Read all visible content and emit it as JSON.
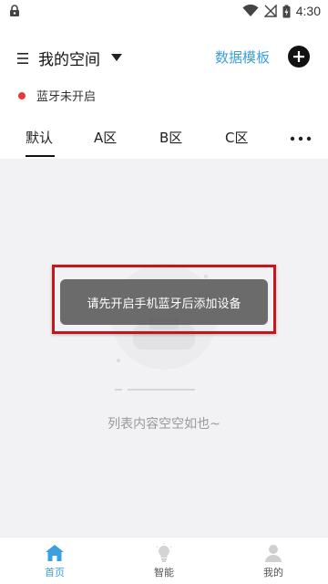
{
  "status_bar": {
    "time": "4:30",
    "icons": [
      "lock-icon",
      "wifi-icon",
      "no-signal-icon",
      "battery-charging-icon"
    ]
  },
  "header": {
    "space_title": "我的空间",
    "template_link": "数据模板",
    "icons": [
      "menu-icon",
      "caret-down-icon",
      "add-icon"
    ]
  },
  "bluetooth_status": {
    "text": "蓝牙未开启",
    "dot_color": "#e53a3a"
  },
  "tabs": {
    "items": [
      "默认",
      "A区",
      "B区",
      "C区"
    ],
    "active_index": 0,
    "more_icon": "more-dots-icon"
  },
  "empty_state": {
    "text": "列表内容空空如也~"
  },
  "toast": {
    "text": "请先开启手机蓝牙后添加设备"
  },
  "bottom_nav": {
    "items": [
      {
        "label": "首页",
        "icon": "home-icon",
        "active": true
      },
      {
        "label": "智能",
        "icon": "bulb-icon",
        "active": false
      },
      {
        "label": "我的",
        "icon": "user-icon",
        "active": false
      }
    ],
    "active_color": "#3b9fe0",
    "inactive_color": "#555555"
  },
  "colors": {
    "accent": "#3b9fe0",
    "toast_highlight": "#c4161c"
  }
}
